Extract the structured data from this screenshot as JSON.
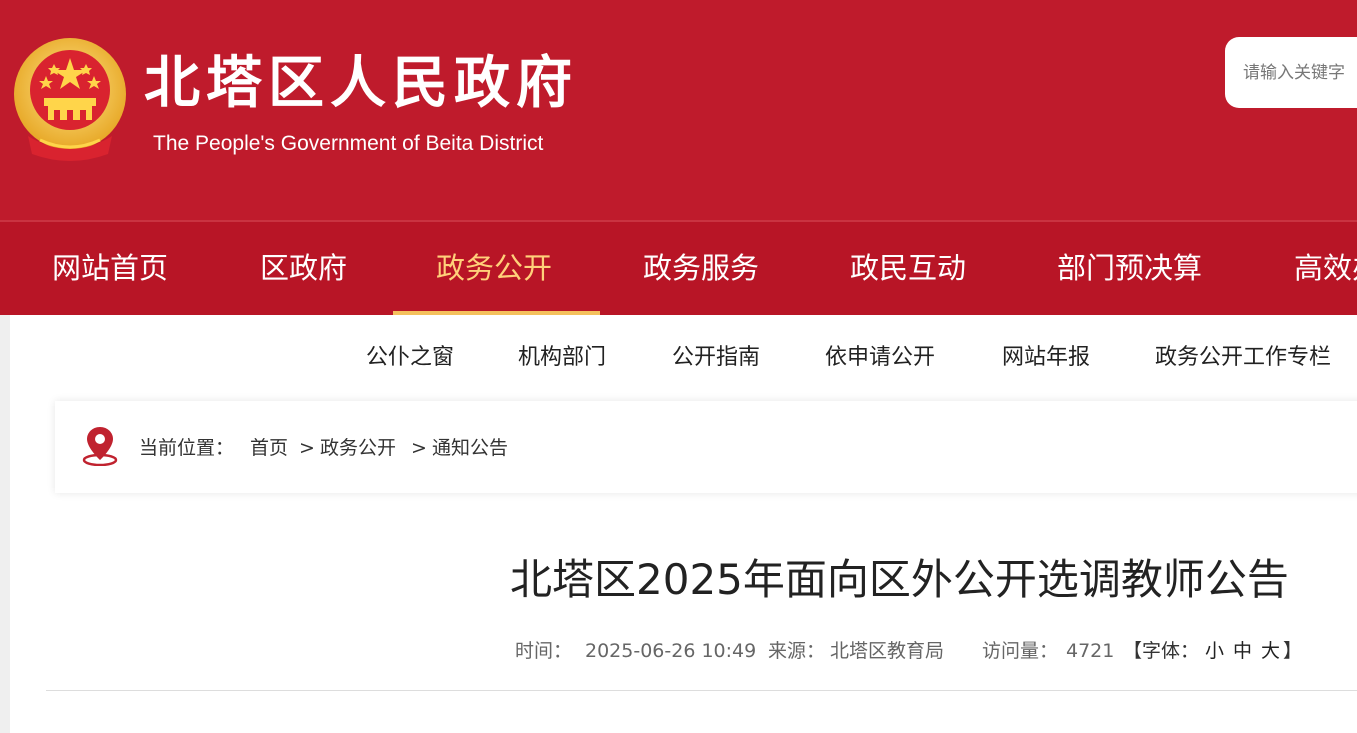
{
  "header": {
    "site_title": "北塔区人民政府",
    "site_subtitle": "The People's Government of Beita District",
    "search_placeholder": "请输入关键字"
  },
  "colors": {
    "header_bg": "#bf1b2c",
    "nav_bg": "#b81526",
    "nav_active": "#ffd07a",
    "icon_red": "#c0222f"
  },
  "main_nav": {
    "items": [
      {
        "label": "网站首页"
      },
      {
        "label": "区政府"
      },
      {
        "label": "政务公开",
        "active": true
      },
      {
        "label": "政务服务"
      },
      {
        "label": "政民互动"
      },
      {
        "label": "部门预决算"
      },
      {
        "label": "高效办成一件事"
      }
    ]
  },
  "sub_nav": {
    "items": [
      {
        "label": "公仆之窗"
      },
      {
        "label": "机构部门"
      },
      {
        "label": "公开指南"
      },
      {
        "label": "依申请公开"
      },
      {
        "label": "网站年报"
      },
      {
        "label": "政务公开工作专栏"
      }
    ]
  },
  "breadcrumb": {
    "prefix": "当前位置：",
    "items": [
      "首页",
      "政务公开",
      "通知公告"
    ],
    "separator": ">",
    "icon": "location-pin-icon"
  },
  "article": {
    "title": "北塔区2025年面向区外公开选调教师公告",
    "time_label": "时间：",
    "time_value": "2025-06-26 10:49",
    "source_label": "来源：",
    "source_value": "北塔区教育局",
    "views_label": "访问量：",
    "views_value": "4721",
    "font_label": "【字体：",
    "font_options": [
      "小",
      "中",
      "大"
    ],
    "font_close": "】"
  }
}
